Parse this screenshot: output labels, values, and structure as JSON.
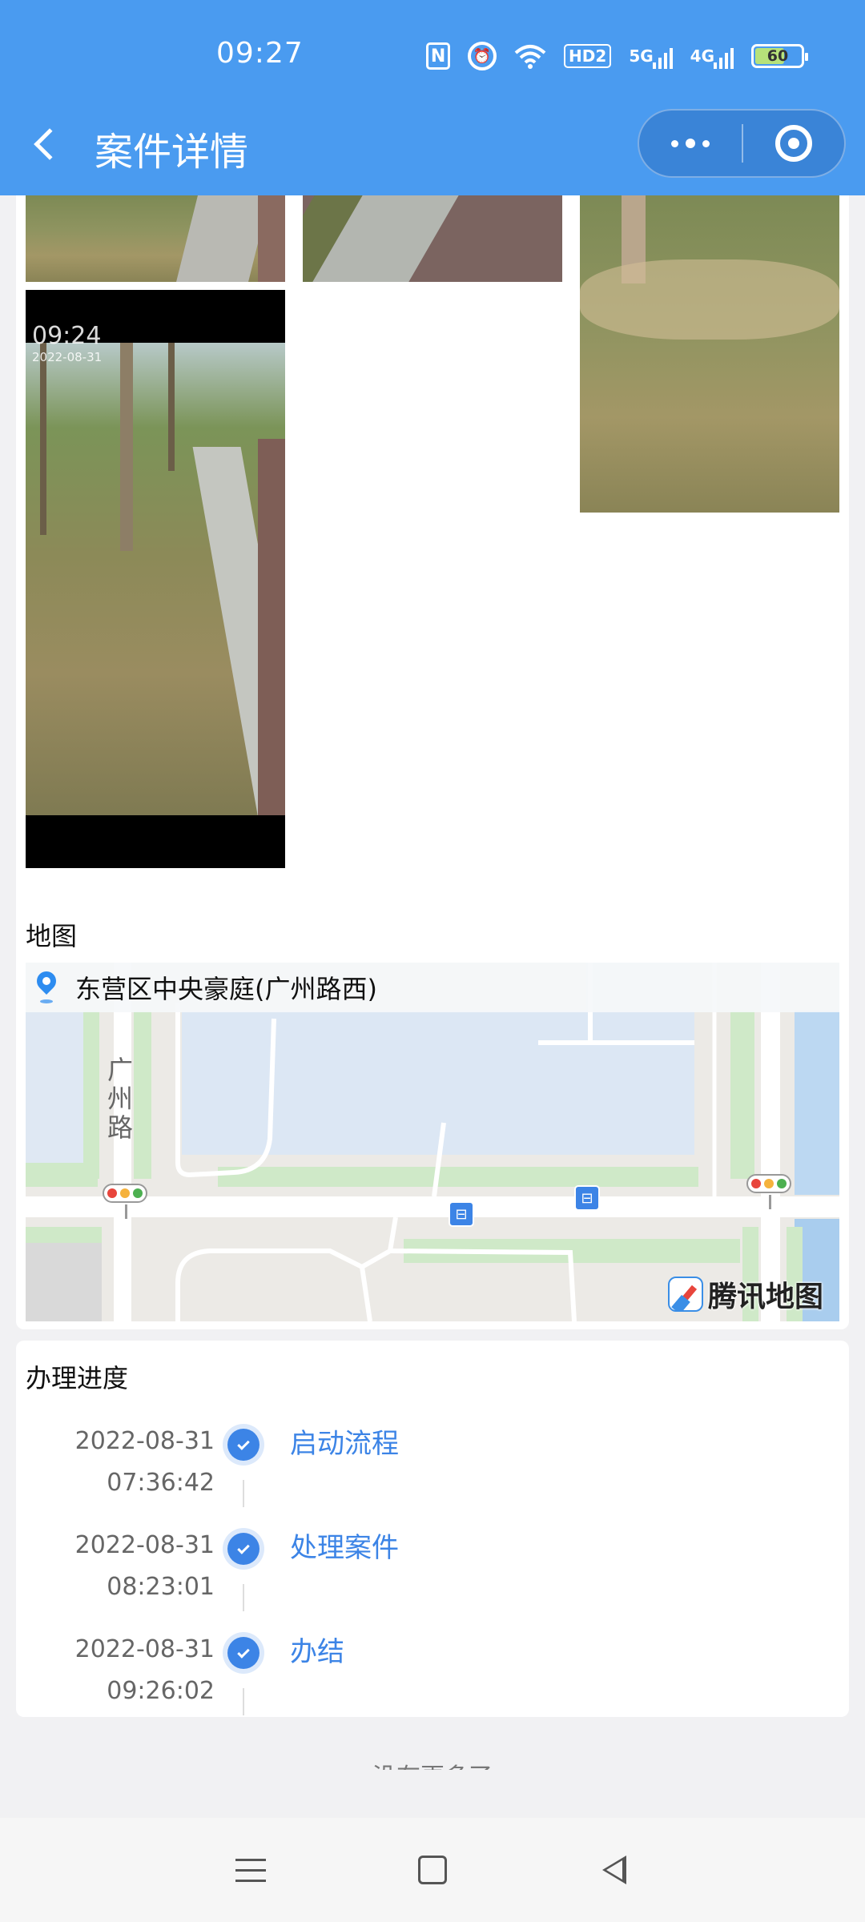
{
  "status_bar": {
    "time": "09:27",
    "nfc": "N",
    "hd": "HD2",
    "net1": "5G",
    "net2": "4G",
    "battery": "60"
  },
  "header": {
    "title": "案件详情"
  },
  "photos": {
    "video_overlay_time": "09:24",
    "video_overlay_date": "2022-08-31"
  },
  "map": {
    "section_title": "地图",
    "address": "东营区中央豪庭(广州路西)",
    "road_label": "广州路",
    "road_label_chars": [
      "广",
      "州",
      "路"
    ],
    "bus_icon": "bus-stop-icon",
    "provider_text": "腾讯地图"
  },
  "progress": {
    "section_title": "办理进度",
    "steps": [
      {
        "date": "2022-08-31",
        "time": "07:36:42",
        "label": "启动流程"
      },
      {
        "date": "2022-08-31",
        "time": "08:23:01",
        "label": "处理案件"
      },
      {
        "date": "2022-08-31",
        "time": "09:26:02",
        "label": "办结"
      }
    ]
  },
  "footer": {
    "no_more": "没有更多了"
  },
  "colors": {
    "header_bg": "#4a9bf0",
    "accent": "#3c84e6",
    "page_bg": "#f1f1f3"
  }
}
